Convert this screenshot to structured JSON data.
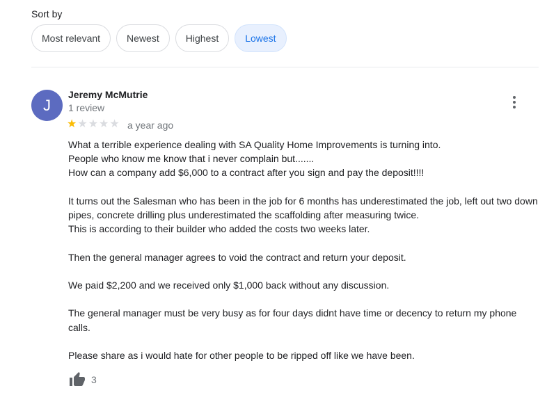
{
  "sort": {
    "label": "Sort by",
    "options": [
      {
        "label": "Most relevant",
        "selected": false
      },
      {
        "label": "Newest",
        "selected": false
      },
      {
        "label": "Highest",
        "selected": false
      },
      {
        "label": "Lowest",
        "selected": true
      }
    ]
  },
  "review": {
    "avatar_initial": "J",
    "avatar_color": "#5c6bc0",
    "author": "Jeremy McMutrie",
    "review_count": "1 review",
    "rating": 1,
    "rating_max": 5,
    "date": "a year ago",
    "more_icon": "more-vert-icon",
    "paragraphs": [
      [
        "What a terrible experience dealing with SA Quality Home Improvements is turning into.",
        "People who know me know that i never complain but.......",
        "How can a company add $6,000 to a contract after you sign and pay the deposit!!!!"
      ],
      [
        "It turns out the Salesman who has been in the job for 6 months has underestimated the job, left out two down pipes, concrete drilling plus underestimated the scaffolding after measuring twice.",
        "This is according to their builder who added the costs two weeks later."
      ],
      [
        "Then the general manager agrees to void the contract and return your deposit."
      ],
      [
        "We paid $2,200 and we received only $1,000 back without any discussion."
      ],
      [
        "The general manager must be very busy as for four days didnt have time or decency to return my phone calls."
      ],
      [
        "Please share as i would hate for other people to be ripped off like we have been."
      ]
    ],
    "likes": "3",
    "like_icon": "thumbs-up-icon"
  }
}
